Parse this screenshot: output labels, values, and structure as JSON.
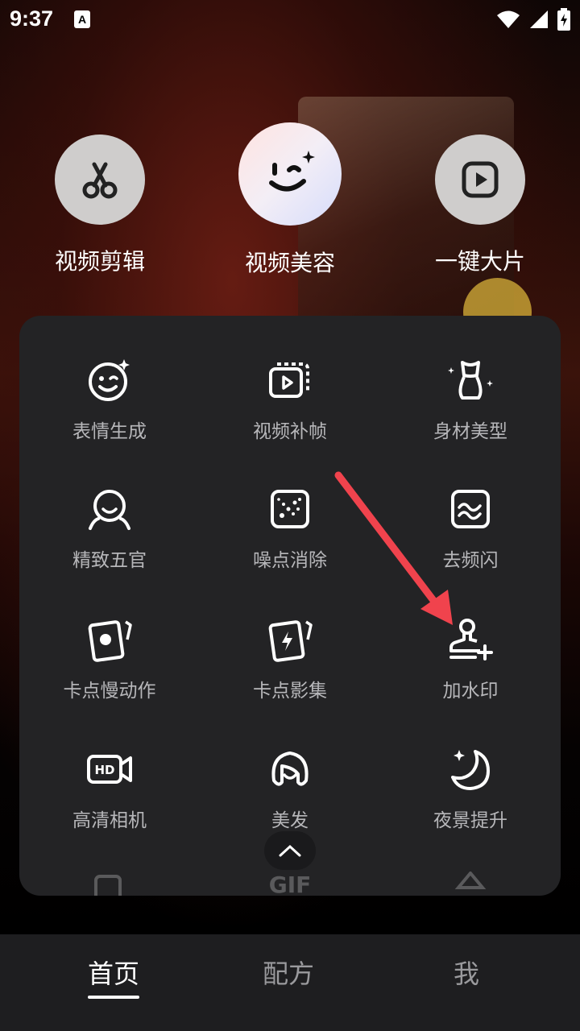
{
  "status_bar": {
    "time": "9:37",
    "notif_glyph": "A",
    "icons": [
      "wifi-icon",
      "signal-icon",
      "battery-charging-icon"
    ]
  },
  "features": [
    {
      "label": "视频剪辑",
      "icon": "scissors-icon"
    },
    {
      "label": "视频美容",
      "icon": "wink-face-icon"
    },
    {
      "label": "一键大片",
      "icon": "play-square-icon"
    }
  ],
  "tools": [
    {
      "label": "表情生成",
      "icon": "smile-sparkle-icon"
    },
    {
      "label": "视频补帧",
      "icon": "video-frames-icon"
    },
    {
      "label": "身材美型",
      "icon": "body-shape-icon"
    },
    {
      "label": "精致五官",
      "icon": "face-outline-icon"
    },
    {
      "label": "噪点消除",
      "icon": "noise-grid-icon"
    },
    {
      "label": "去频闪",
      "icon": "flicker-wave-icon"
    },
    {
      "label": "卡点慢动作",
      "icon": "slowmo-card-icon"
    },
    {
      "label": "卡点影集",
      "icon": "flash-card-icon"
    },
    {
      "label": "加水印",
      "icon": "stamp-add-icon"
    },
    {
      "label": "高清相机",
      "icon": "hd-camera-icon"
    },
    {
      "label": "美发",
      "icon": "hair-icon"
    },
    {
      "label": "夜景提升",
      "icon": "moon-star-icon"
    }
  ],
  "faded_row": [
    "",
    "GIF",
    ""
  ],
  "bottom_nav": [
    {
      "label": "首页",
      "active": true
    },
    {
      "label": "配方",
      "active": false
    },
    {
      "label": "我",
      "active": false
    }
  ],
  "colors": {
    "accent_arrow": "#f0434d",
    "panel_bg": "#232325",
    "nav_bg": "#1e1e20"
  }
}
